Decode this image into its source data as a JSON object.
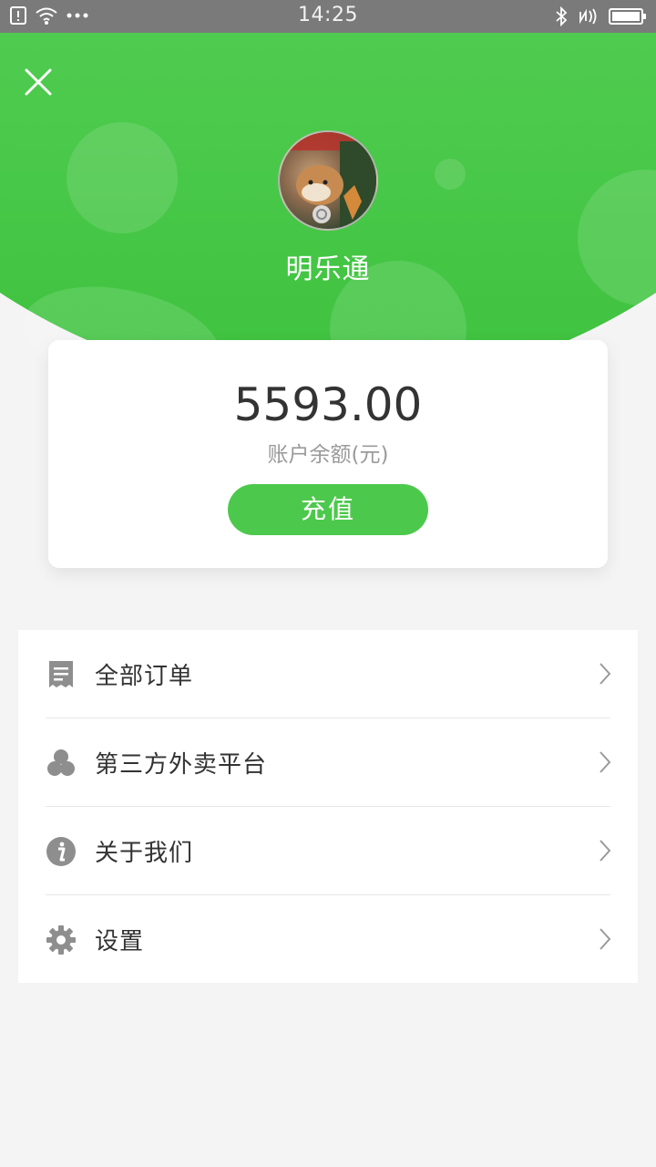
{
  "status_bar": {
    "time": "14:25",
    "icons": [
      "sim-icon",
      "wifi-icon",
      "more-dots-icon",
      "bluetooth-icon",
      "nfc-icon",
      "battery-icon"
    ]
  },
  "header": {
    "close_icon": "close-icon",
    "username": "明乐通",
    "accent_color": "#4cc94c"
  },
  "balance": {
    "amount": "5593.00",
    "label": "账户余额(元)",
    "recharge_label": "充值"
  },
  "menu": {
    "items": [
      {
        "label": "全部订单",
        "icon": "receipt-icon"
      },
      {
        "label": "第三方外卖平台",
        "icon": "circles-icon"
      },
      {
        "label": "关于我们",
        "icon": "info-icon"
      },
      {
        "label": "设置",
        "icon": "gear-icon"
      }
    ]
  }
}
